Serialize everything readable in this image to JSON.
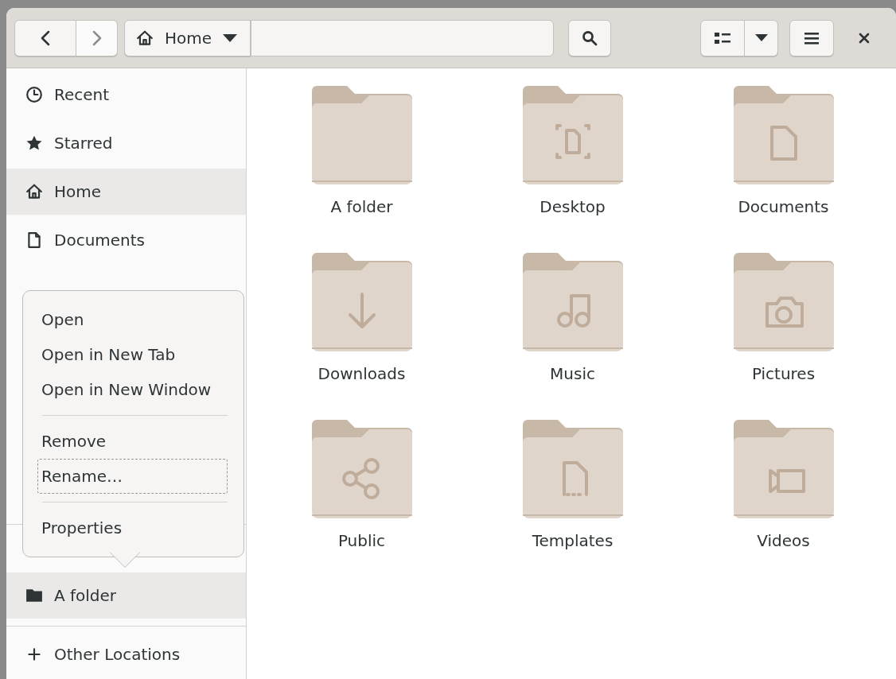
{
  "header": {
    "location": {
      "label": "Home"
    }
  },
  "sidebar": {
    "items": [
      {
        "label": "Recent",
        "kind": "clock",
        "selected": false
      },
      {
        "label": "Starred",
        "kind": "star",
        "selected": false
      },
      {
        "label": "Home",
        "kind": "home",
        "selected": true
      },
      {
        "label": "Documents",
        "kind": "document",
        "selected": false
      }
    ],
    "bottom_items": [
      {
        "label": "A folder",
        "kind": "folder",
        "selected": true
      },
      {
        "label": "Other Locations",
        "kind": "plus",
        "selected": false
      }
    ]
  },
  "context_menu": {
    "groups": [
      [
        {
          "label": "Open",
          "focused": false
        },
        {
          "label": "Open in New Tab",
          "focused": false
        },
        {
          "label": "Open in New Window",
          "focused": false
        }
      ],
      [
        {
          "label": "Remove",
          "focused": false
        },
        {
          "label": "Rename…",
          "focused": true
        }
      ],
      [
        {
          "label": "Properties",
          "focused": false
        }
      ]
    ]
  },
  "folders": [
    {
      "name": "A folder",
      "kind": "plain"
    },
    {
      "name": "Desktop",
      "kind": "desktop"
    },
    {
      "name": "Documents",
      "kind": "document"
    },
    {
      "name": "Downloads",
      "kind": "download"
    },
    {
      "name": "Music",
      "kind": "music"
    },
    {
      "name": "Pictures",
      "kind": "pictures"
    },
    {
      "name": "Public",
      "kind": "share"
    },
    {
      "name": "Templates",
      "kind": "template"
    },
    {
      "name": "Videos",
      "kind": "video"
    }
  ]
}
